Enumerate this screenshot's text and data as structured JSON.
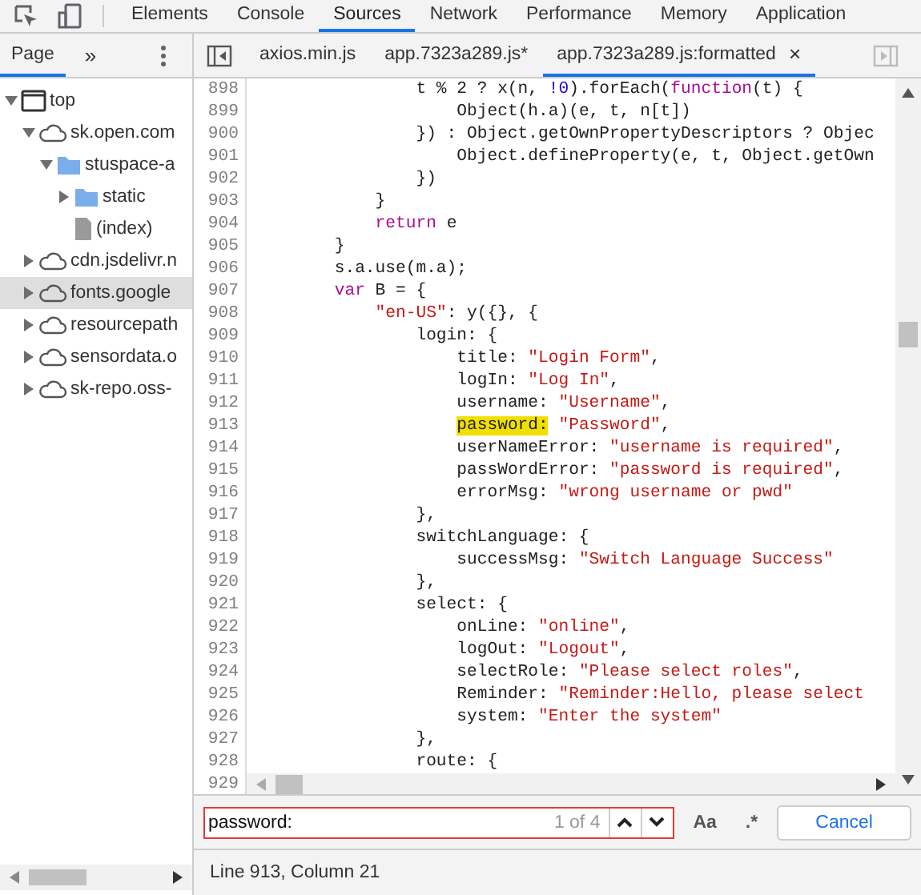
{
  "main_tabs": [
    {
      "label": "Elements",
      "selected": false
    },
    {
      "label": "Console",
      "selected": false
    },
    {
      "label": "Sources",
      "selected": true
    },
    {
      "label": "Network",
      "selected": false
    },
    {
      "label": "Performance",
      "selected": false
    },
    {
      "label": "Memory",
      "selected": false
    },
    {
      "label": "Application",
      "selected": false
    }
  ],
  "navigator": {
    "tabs": [
      {
        "label": "Page",
        "selected": true
      }
    ],
    "more": "»",
    "tree": [
      {
        "label": "top",
        "kind": "frame",
        "expanded": true,
        "selected": false,
        "children": [
          {
            "label": "sk.open.com",
            "kind": "domain",
            "expanded": true,
            "selected": false,
            "children": [
              {
                "label": "stuspace-a",
                "kind": "folder",
                "expanded": true,
                "selected": false,
                "children": [
                  {
                    "label": "static",
                    "kind": "folder",
                    "expanded": false,
                    "selected": false
                  },
                  {
                    "label": "(index)",
                    "kind": "file",
                    "selected": false
                  }
                ]
              }
            ]
          },
          {
            "label": "cdn.jsdelivr.n",
            "kind": "domain",
            "expanded": false,
            "selected": false
          },
          {
            "label": "fonts.google",
            "kind": "domain",
            "expanded": false,
            "selected": true
          },
          {
            "label": "resourcepath",
            "kind": "domain",
            "expanded": false,
            "selected": false
          },
          {
            "label": "sensordata.o",
            "kind": "domain",
            "expanded": false,
            "selected": false
          },
          {
            "label": "sk-repo.oss-",
            "kind": "domain",
            "expanded": false,
            "selected": false
          }
        ]
      }
    ]
  },
  "file_tabs": [
    {
      "label": "axios.min.js",
      "selected": false
    },
    {
      "label": "app.7323a289.js*",
      "selected": false
    },
    {
      "label": "app.7323a289.js:formatted",
      "selected": true,
      "close": "×"
    }
  ],
  "code_lines": [
    {
      "number": "898",
      "tokens": [
        {
          "kind": "plain",
          "text": "                t % 2 ? x(n, "
        },
        {
          "kind": "number",
          "text": "!0"
        },
        {
          "kind": "plain",
          "text": ").forEach("
        },
        {
          "kind": "keyword",
          "text": "function"
        },
        {
          "kind": "plain",
          "text": "(t) {"
        }
      ]
    },
    {
      "number": "899",
      "tokens": [
        {
          "kind": "plain",
          "text": "                    Object(h.a)(e, t, n[t])"
        }
      ]
    },
    {
      "number": "900",
      "tokens": [
        {
          "kind": "plain",
          "text": "                }) : Object.getOwnPropertyDescriptors ? Objec"
        }
      ]
    },
    {
      "number": "901",
      "tokens": [
        {
          "kind": "plain",
          "text": "                    Object.defineProperty(e, t, Object.getOwn"
        }
      ]
    },
    {
      "number": "902",
      "tokens": [
        {
          "kind": "plain",
          "text": "                })"
        }
      ]
    },
    {
      "number": "903",
      "tokens": [
        {
          "kind": "plain",
          "text": "            }"
        }
      ]
    },
    {
      "number": "904",
      "tokens": [
        {
          "kind": "keyword",
          "text": "            return"
        },
        {
          "kind": "plain",
          "text": " e"
        }
      ]
    },
    {
      "number": "905",
      "tokens": [
        {
          "kind": "plain",
          "text": "        }"
        }
      ]
    },
    {
      "number": "906",
      "tokens": [
        {
          "kind": "plain",
          "text": "        s.a.use(m.a);"
        }
      ]
    },
    {
      "number": "907",
      "tokens": [
        {
          "kind": "keyword",
          "text": "        var"
        },
        {
          "kind": "plain",
          "text": " B = {"
        }
      ]
    },
    {
      "number": "908",
      "tokens": [
        {
          "kind": "string",
          "text": "            \"en-US\""
        },
        {
          "kind": "plain",
          "text": ": y({}, {"
        }
      ]
    },
    {
      "number": "909",
      "tokens": [
        {
          "kind": "plain",
          "text": "                login: {"
        }
      ]
    },
    {
      "number": "910",
      "tokens": [
        {
          "kind": "plain",
          "text": "                    title: "
        },
        {
          "kind": "string",
          "text": "\"Login Form\""
        },
        {
          "kind": "plain",
          "text": ","
        }
      ]
    },
    {
      "number": "911",
      "tokens": [
        {
          "kind": "plain",
          "text": "                    logIn: "
        },
        {
          "kind": "string",
          "text": "\"Log In\""
        },
        {
          "kind": "plain",
          "text": ","
        }
      ]
    },
    {
      "number": "912",
      "tokens": [
        {
          "kind": "plain",
          "text": "                    username: "
        },
        {
          "kind": "string",
          "text": "\"Username\""
        },
        {
          "kind": "plain",
          "text": ","
        }
      ]
    },
    {
      "number": "913",
      "tokens": [
        {
          "kind": "match",
          "text": "                    password:"
        },
        {
          "kind": "string",
          "text": " \"Password\""
        },
        {
          "kind": "plain",
          "text": ","
        }
      ]
    },
    {
      "number": "914",
      "tokens": [
        {
          "kind": "plain",
          "text": "                    userNameError: "
        },
        {
          "kind": "string",
          "text": "\"username is required\""
        },
        {
          "kind": "plain",
          "text": ","
        }
      ]
    },
    {
      "number": "915",
      "tokens": [
        {
          "kind": "plain",
          "text": "                    passWordError: "
        },
        {
          "kind": "string",
          "text": "\"password is required\""
        },
        {
          "kind": "plain",
          "text": ","
        }
      ]
    },
    {
      "number": "916",
      "tokens": [
        {
          "kind": "plain",
          "text": "                    errorMsg: "
        },
        {
          "kind": "string",
          "text": "\"wrong username or pwd\""
        }
      ]
    },
    {
      "number": "917",
      "tokens": [
        {
          "kind": "plain",
          "text": "                },"
        }
      ]
    },
    {
      "number": "918",
      "tokens": [
        {
          "kind": "plain",
          "text": "                switchLanguage: {"
        }
      ]
    },
    {
      "number": "919",
      "tokens": [
        {
          "kind": "plain",
          "text": "                    successMsg: "
        },
        {
          "kind": "string",
          "text": "\"Switch Language Success\""
        }
      ]
    },
    {
      "number": "920",
      "tokens": [
        {
          "kind": "plain",
          "text": "                },"
        }
      ]
    },
    {
      "number": "921",
      "tokens": [
        {
          "kind": "plain",
          "text": "                select: {"
        }
      ]
    },
    {
      "number": "922",
      "tokens": [
        {
          "kind": "plain",
          "text": "                    onLine: "
        },
        {
          "kind": "string",
          "text": "\"online\""
        },
        {
          "kind": "plain",
          "text": ","
        }
      ]
    },
    {
      "number": "923",
      "tokens": [
        {
          "kind": "plain",
          "text": "                    logOut: "
        },
        {
          "kind": "string",
          "text": "\"Logout\""
        },
        {
          "kind": "plain",
          "text": ","
        }
      ]
    },
    {
      "number": "924",
      "tokens": [
        {
          "kind": "plain",
          "text": "                    selectRole: "
        },
        {
          "kind": "string",
          "text": "\"Please select roles\""
        },
        {
          "kind": "plain",
          "text": ","
        }
      ]
    },
    {
      "number": "925",
      "tokens": [
        {
          "kind": "plain",
          "text": "                    Reminder: "
        },
        {
          "kind": "string",
          "text": "\"Reminder:Hello, please select"
        }
      ]
    },
    {
      "number": "926",
      "tokens": [
        {
          "kind": "plain",
          "text": "                    system: "
        },
        {
          "kind": "string",
          "text": "\"Enter the system\""
        }
      ]
    },
    {
      "number": "927",
      "tokens": [
        {
          "kind": "plain",
          "text": "                },"
        }
      ]
    },
    {
      "number": "928",
      "tokens": [
        {
          "kind": "plain",
          "text": "                route: {"
        }
      ]
    }
  ],
  "last_line_number": "929",
  "search": {
    "value": "password:",
    "count": "1 of 4",
    "match_case": "Aa",
    "regex": ".*",
    "cancel": "Cancel"
  },
  "status_bar": "Line 913, Column 21"
}
